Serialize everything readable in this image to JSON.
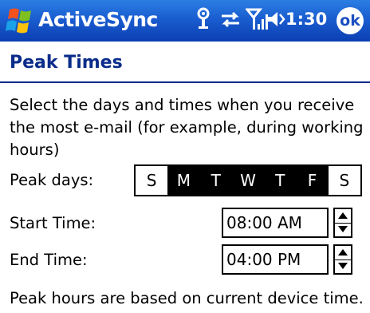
{
  "titlebar": {
    "app_title": "ActiveSync",
    "time": "1:30",
    "ok_label": "ok",
    "icons": [
      "windows-start-icon",
      "connectivity-icon",
      "sync-arrows-icon",
      "signal-strength-icon",
      "volume-icon"
    ]
  },
  "page": {
    "title": "Peak Times",
    "description": "Select the days and times when you receive the most e-mail (for example, during working hours)"
  },
  "peak_days": {
    "label": "Peak days:",
    "days": [
      {
        "letter": "S",
        "selected": false
      },
      {
        "letter": "M",
        "selected": true
      },
      {
        "letter": "T",
        "selected": true
      },
      {
        "letter": "W",
        "selected": true
      },
      {
        "letter": "T",
        "selected": true
      },
      {
        "letter": "F",
        "selected": true
      },
      {
        "letter": "S",
        "selected": false
      }
    ]
  },
  "start_time": {
    "label": "Start Time:",
    "value": "08:00 AM"
  },
  "end_time": {
    "label": "End Time:",
    "value": "04:00 PM"
  },
  "footnote": "Peak hours are based on current device time.",
  "colors": {
    "title_bar": "#1a5dd0",
    "header_text": "#0a2c8a"
  }
}
